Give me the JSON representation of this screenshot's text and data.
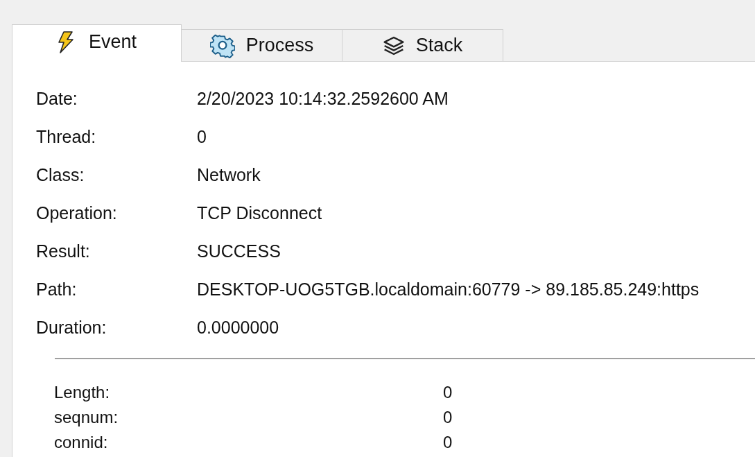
{
  "tabs": [
    {
      "label": "Event",
      "selected": true,
      "kind": "bolt"
    },
    {
      "label": "Process",
      "selected": false,
      "kind": "gear"
    },
    {
      "label": "Stack",
      "selected": false,
      "kind": "layers"
    }
  ],
  "properties": [
    {
      "label": "Date:",
      "value": "2/20/2023 10:14:32.2592600 AM"
    },
    {
      "label": "Thread:",
      "value": "0"
    },
    {
      "label": "Class:",
      "value": "Network"
    },
    {
      "label": "Operation:",
      "value": "TCP Disconnect"
    },
    {
      "label": "Result:",
      "value": "SUCCESS"
    },
    {
      "label": "Path:",
      "value": "DESKTOP-UOG5TGB.localdomain:60779 -> 89.185.85.249:https"
    },
    {
      "label": "Duration:",
      "value": "0.0000000"
    }
  ],
  "details": [
    {
      "label": "Length:",
      "value": "0"
    },
    {
      "label": "seqnum:",
      "value": "0"
    },
    {
      "label": "connid:",
      "value": "0"
    }
  ]
}
